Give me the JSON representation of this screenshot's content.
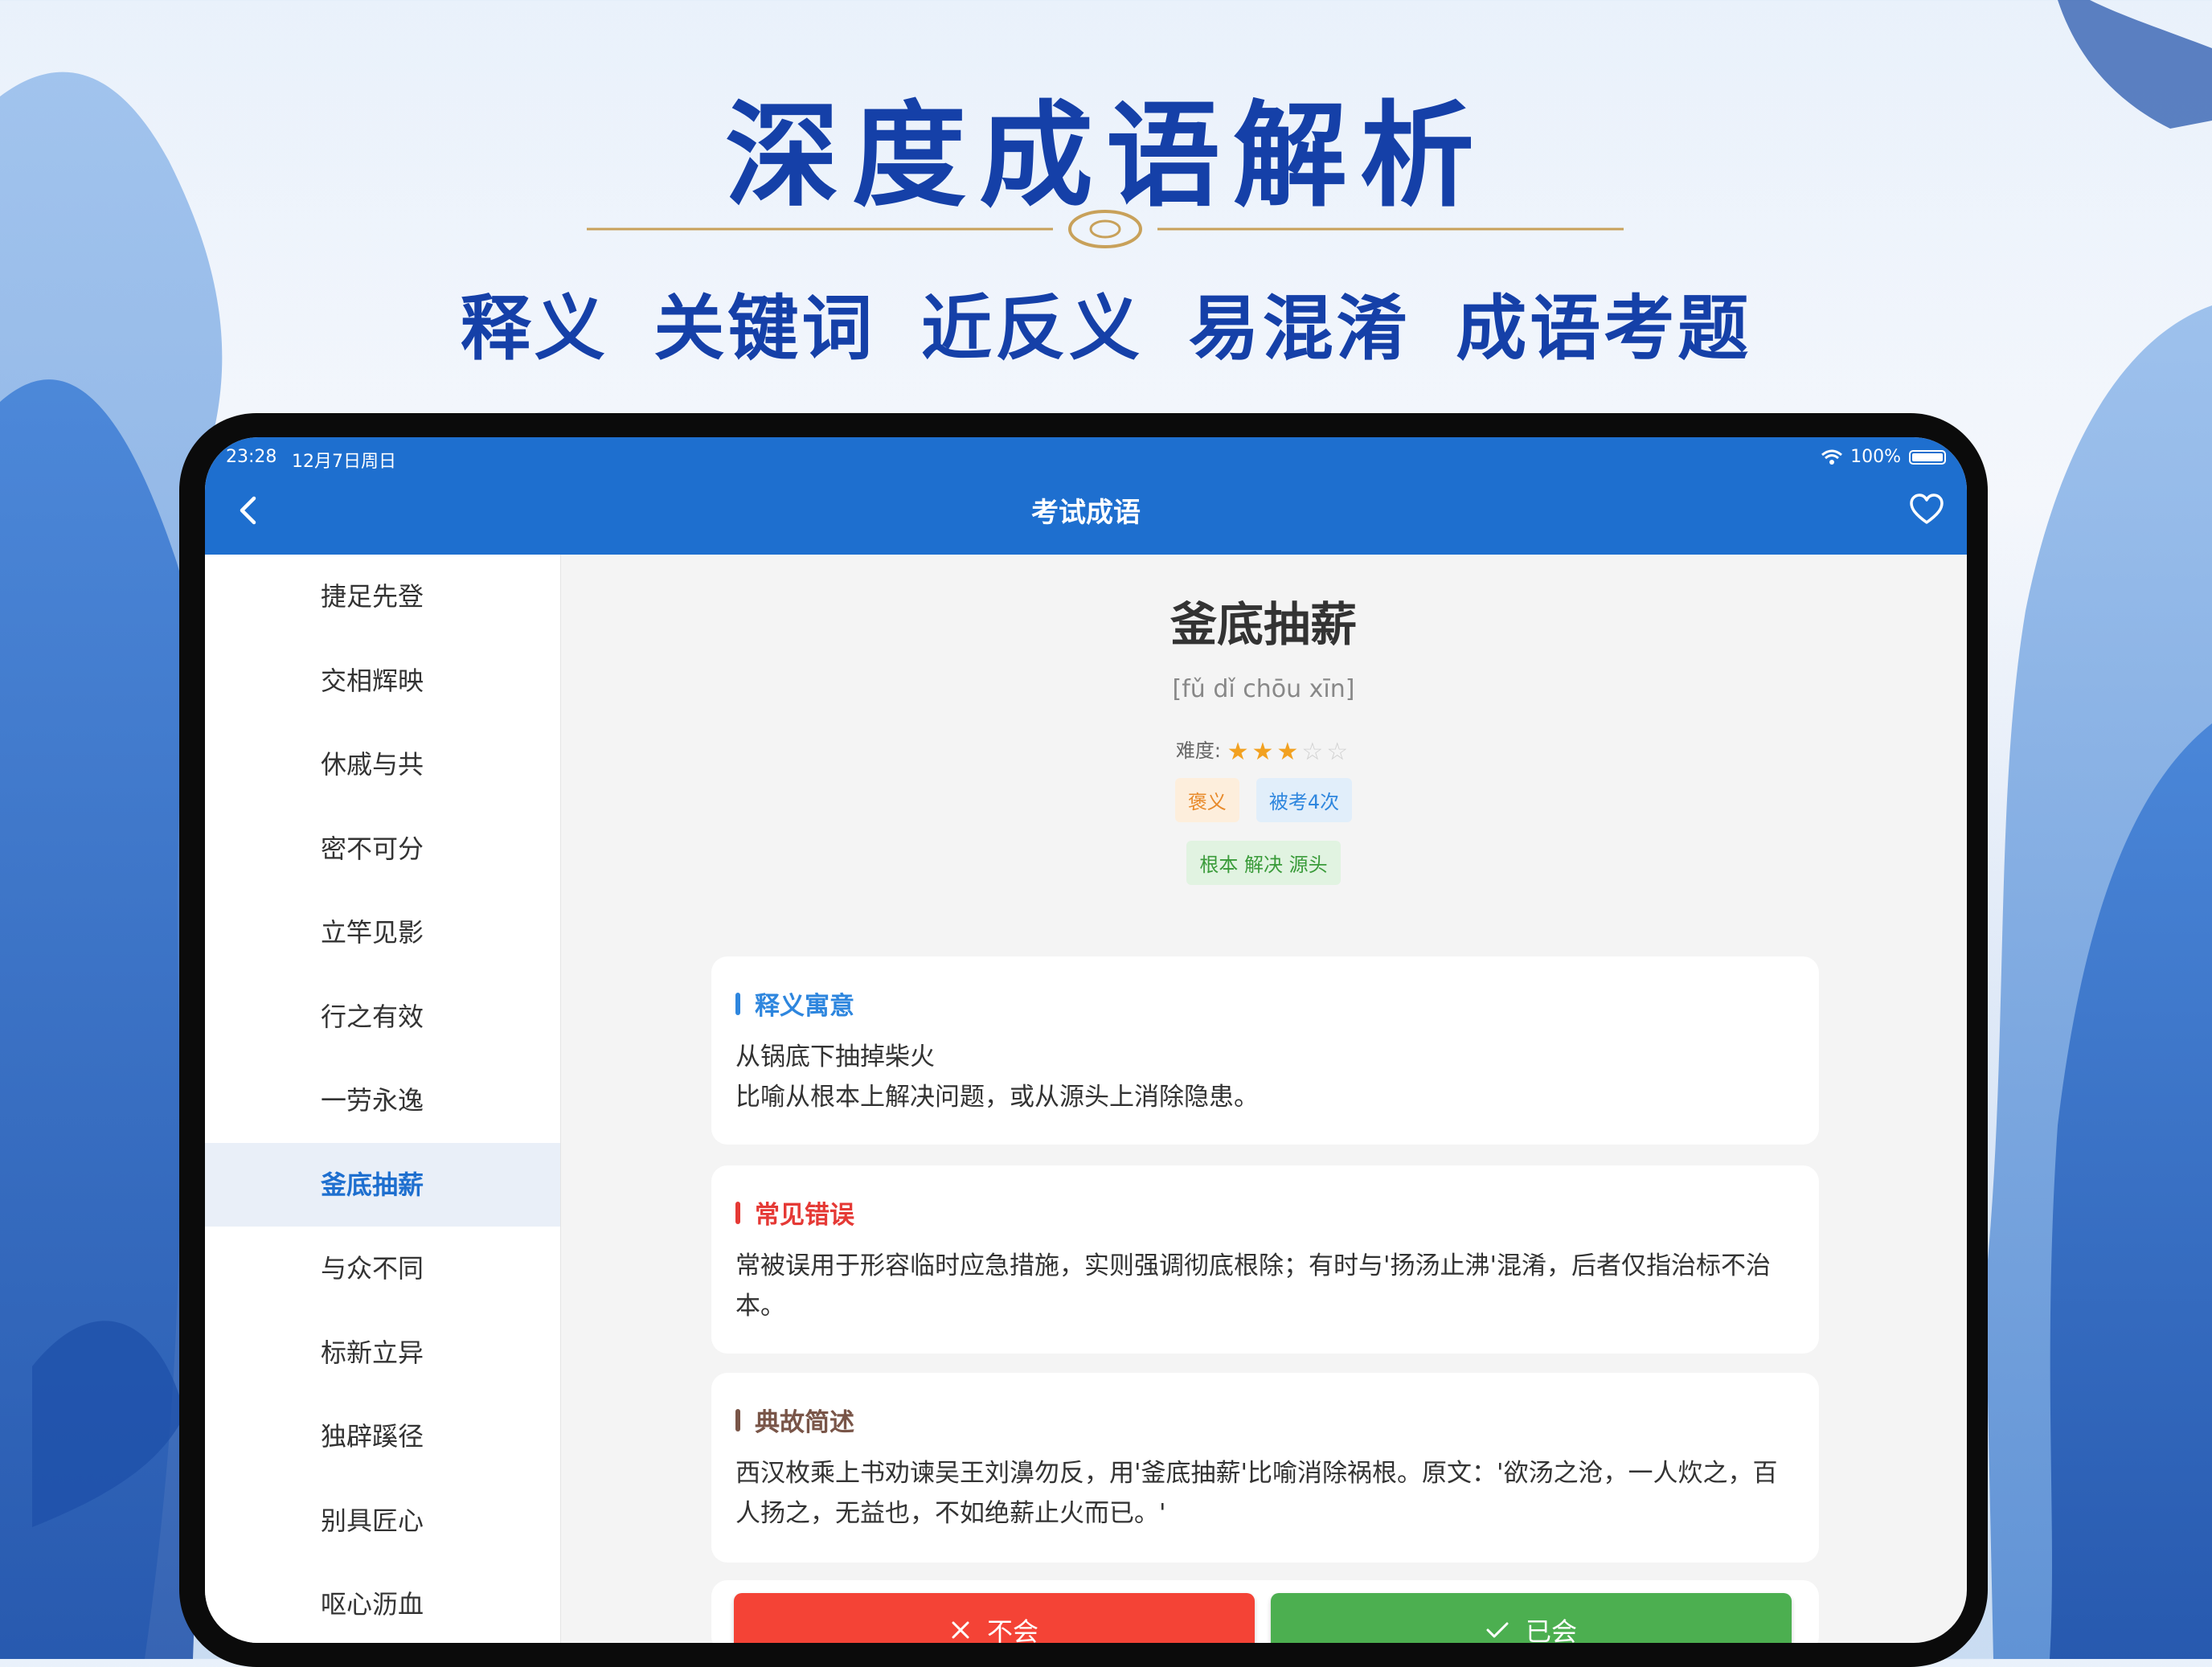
{
  "banner": {
    "headline": "深度成语解析",
    "subheadline": "释义 关键词 近反义 易混淆 成语考题"
  },
  "status_bar": {
    "time": "23:28",
    "date": "12月7日周日",
    "battery": "100%"
  },
  "nav": {
    "title": "考试成语",
    "back_icon": "chevron-left-icon",
    "favorite_icon": "heart-outline-icon"
  },
  "sidebar": {
    "items": [
      {
        "label": "捷足先登"
      },
      {
        "label": "交相辉映"
      },
      {
        "label": "休戚与共"
      },
      {
        "label": "密不可分"
      },
      {
        "label": "立竿见影"
      },
      {
        "label": "行之有效"
      },
      {
        "label": "一劳永逸"
      },
      {
        "label": "釜底抽薪",
        "active": true
      },
      {
        "label": "与众不同"
      },
      {
        "label": "标新立异"
      },
      {
        "label": "独辟蹊径"
      },
      {
        "label": "别具匠心"
      },
      {
        "label": "呕心沥血"
      }
    ]
  },
  "detail": {
    "title": "釜底抽薪",
    "pinyin": "[fǔ dǐ chōu xīn]",
    "difficulty_label": "难度:",
    "difficulty": 3,
    "difficulty_max": 5,
    "tags": [
      "褒义",
      "被考4次"
    ],
    "keywords": "根本 解决 源头",
    "sections": {
      "meaning": {
        "title": "释义寓意",
        "line1": "从锅底下抽掉柴火",
        "line2": "比喻从根本上解决问题，或从源头上消除隐患。"
      },
      "errors": {
        "title": "常见错误",
        "text": "常被误用于形容临时应急措施，实则强调彻底根除；有时与'扬汤止沸'混淆，后者仅指治标不治本。"
      },
      "story": {
        "title": "典故简述",
        "text": "西汉枚乘上书劝谏吴王刘濞勿反，用'釜底抽薪'比喻消除祸根。原文：'欲汤之沧，一人炊之，百人扬之，无益也，不如绝薪止火而已。'"
      }
    }
  },
  "actions": {
    "unknown_label": "不会",
    "known_label": "已会"
  },
  "colors": {
    "primary": "#1e6fcf",
    "danger": "#f44336",
    "success": "#4caf50",
    "star": "#f2a120"
  }
}
